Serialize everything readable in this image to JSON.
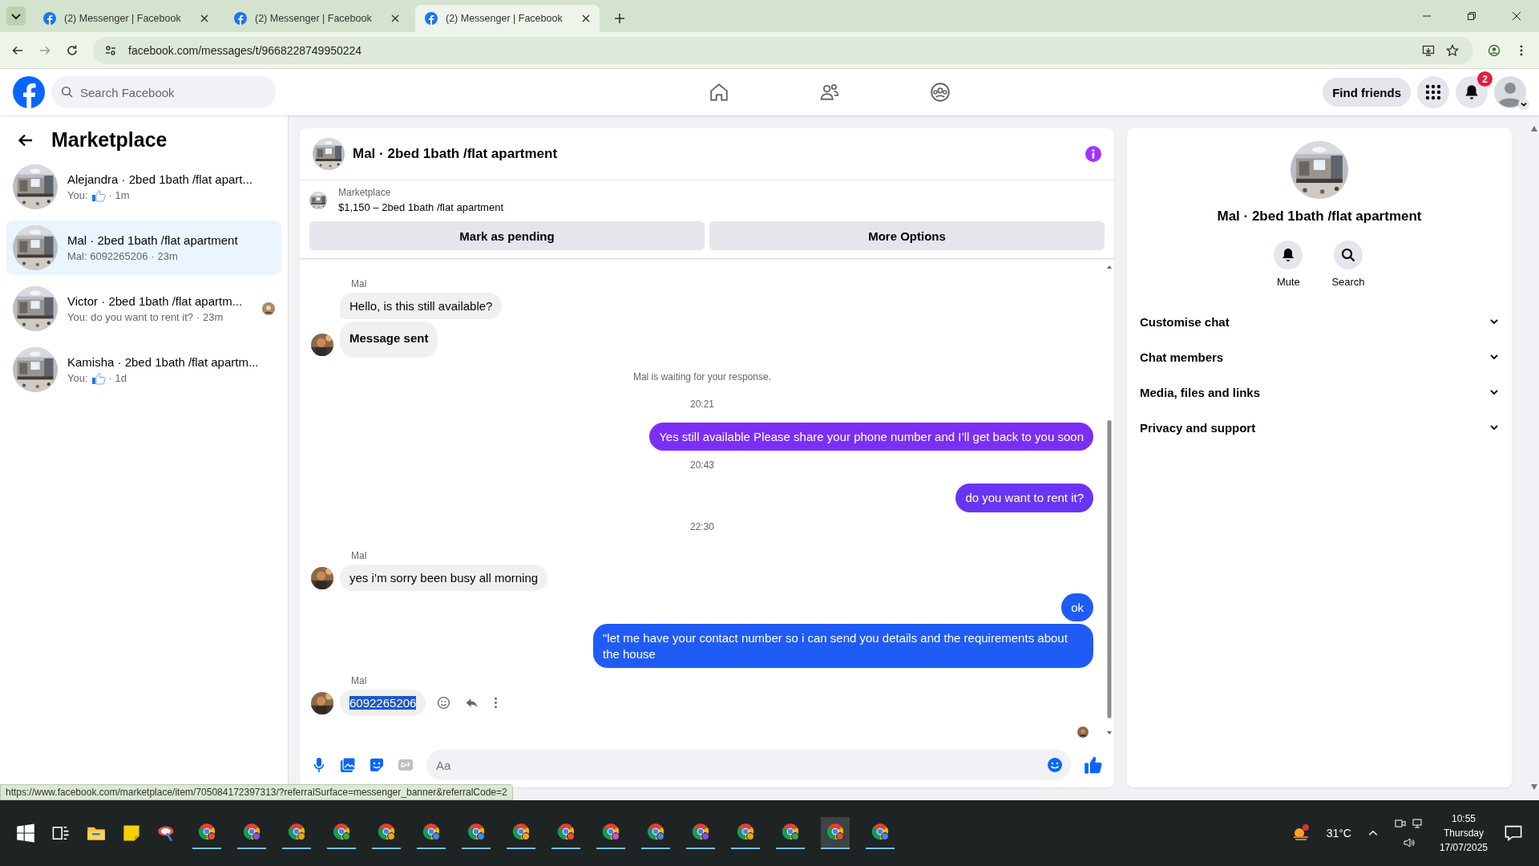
{
  "browser": {
    "tabs": [
      {
        "title": "(2) Messenger | Facebook",
        "selected": false
      },
      {
        "title": "(2) Messenger | Facebook",
        "selected": false
      },
      {
        "title": "(2) Messenger | Facebook",
        "selected": true
      }
    ],
    "url": "facebook.com/messages/t/9668228749950224"
  },
  "header": {
    "search_placeholder": "Search Facebook",
    "find_friends": "Find friends",
    "notification_badge": "2"
  },
  "sidebar": {
    "title": "Marketplace",
    "conversations": [
      {
        "name": "Alejandra · 2bed 1bath /flat apart...",
        "kind": "like",
        "sender": "You:",
        "time": "· 1m",
        "selected": false,
        "seen": false
      },
      {
        "name": "Mal · 2bed 1bath /flat apartment",
        "kind": "text",
        "preview": "Mal: 6092265206",
        "time": "· 23m",
        "selected": true,
        "seen": false
      },
      {
        "name": "Victor · 2bed 1bath /flat apartm...",
        "kind": "text",
        "preview": "You: do you want to rent it?",
        "time": "· 23m",
        "selected": false,
        "seen": true
      },
      {
        "name": "Kamisha · 2bed 1bath /flat apartm...",
        "kind": "like",
        "sender": "You:",
        "time": "· 1d",
        "selected": false,
        "seen": false
      }
    ]
  },
  "chat": {
    "title": "Mal · 2bed 1bath /flat apartment",
    "listing": {
      "label": "Marketplace",
      "summary": "$1,150 – 2bed 1bath /flat apartment"
    },
    "actions": [
      "Mark as pending",
      "More Options"
    ],
    "messages": [
      {
        "kind": "sender",
        "text": "Mal"
      },
      {
        "kind": "incoming",
        "text": "Hello, is this still available?",
        "avatar": false,
        "bold": false,
        "highlighted": false
      },
      {
        "kind": "incoming",
        "text": "Message sent",
        "avatar": true,
        "bold": true,
        "highlighted": false
      },
      {
        "kind": "notice",
        "text": "Mal is waiting for your response."
      },
      {
        "kind": "time",
        "text": "20:21"
      },
      {
        "kind": "outgoing",
        "text": "Yes still available Please share your phone number and I’ll get back to you soon",
        "color": "#7b2ff6"
      },
      {
        "kind": "time",
        "text": "20:43"
      },
      {
        "kind": "outgoing",
        "text": "do you want to rent it?",
        "color": "#6a35f2"
      },
      {
        "kind": "time",
        "text": "22:30"
      },
      {
        "kind": "sender",
        "text": "Mal"
      },
      {
        "kind": "incoming",
        "text": "yes i’m sorry been busy all morning",
        "avatar": true,
        "bold": false,
        "highlighted": false
      },
      {
        "kind": "outgoing",
        "text": "ok",
        "color": "#1f5cf6"
      },
      {
        "kind": "outgoing",
        "text": "\"let me have your contact number so i can send you details and the requirements about the house",
        "color": "#1f5cf6"
      },
      {
        "kind": "sender",
        "text": "Mal"
      },
      {
        "kind": "incoming",
        "text": "6092265206",
        "avatar": true,
        "bold": false,
        "highlighted": true
      }
    ],
    "seen": true,
    "composer_placeholder": "Aa"
  },
  "details": {
    "title": "Mal · 2bed 1bath /flat apartment",
    "actions": [
      {
        "kind": "mute",
        "label": "Mute"
      },
      {
        "kind": "search",
        "label": "Search"
      }
    ],
    "sections": [
      {
        "label": "Customise chat",
        "expanded": false
      },
      {
        "label": "Chat members",
        "expanded": false
      },
      {
        "label": "Media, files and links",
        "expanded": false
      },
      {
        "label": "Privacy and support",
        "expanded": false
      }
    ]
  },
  "status_url": "https://www.facebook.com/marketplace/item/705084172397313/?referralSurface=messenger_banner&referralCode=2",
  "taskbar": {
    "temperature": "31°C",
    "time": "10:55",
    "day": "Thursday",
    "date": "17/07/2025"
  }
}
